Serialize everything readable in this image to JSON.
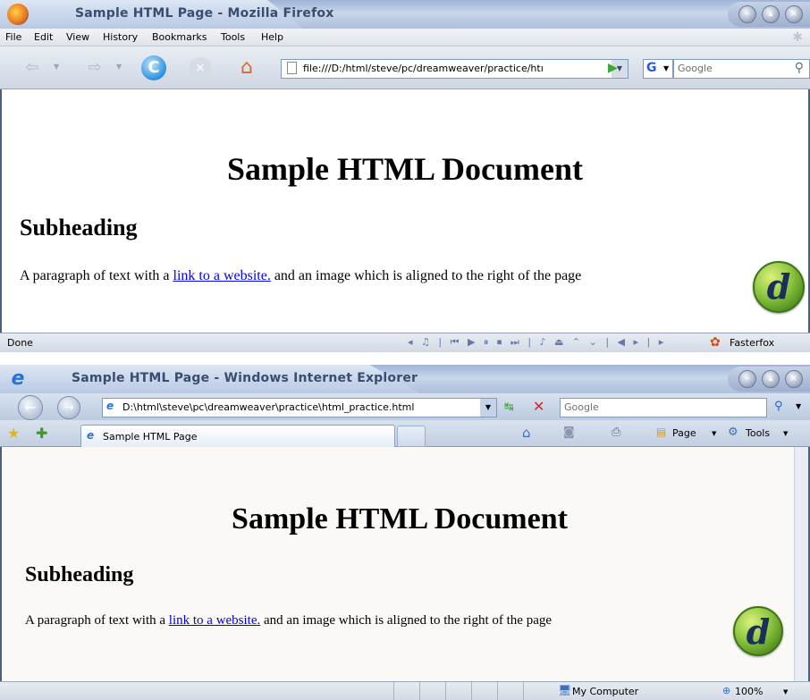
{
  "firefox": {
    "title": "Sample HTML Page - Mozilla Firefox",
    "menu": [
      "File",
      "Edit",
      "View",
      "History",
      "Bookmarks",
      "Tools",
      "Help"
    ],
    "address": "file:///D:/html/steve/pc/dreamweaver/practice/htı",
    "search_placeholder": "Google",
    "status_text": "Done",
    "status_addon": "Fasterfox",
    "icons": [
      "back-icon",
      "forward-icon",
      "reload-icon",
      "stop-icon",
      "home-icon",
      "go-icon",
      "google-icon",
      "search-icon",
      "fasterfox-icon"
    ]
  },
  "ie": {
    "title": "Sample HTML Page - Windows Internet Explorer",
    "address": "D:\\html\\steve\\pc\\dreamweaver\\practice\\html_practice.html",
    "search_placeholder": "Google",
    "tab_label": "Sample HTML Page",
    "page_menu": "Page",
    "tools_menu": "Tools",
    "status_zone": "My Computer",
    "zoom": "100%"
  },
  "document": {
    "heading": "Sample HTML Document",
    "subheading": "Subheading",
    "paragraph_before": "A paragraph of text with a ",
    "link_text": "link to a website.",
    "paragraph_after": " and an image which is aligned to the right of the page",
    "logo_letter": "d"
  },
  "colors": {
    "link": "#0000ee",
    "chrome_blue": "#aebfdc",
    "logo_green": "#8cc43f"
  }
}
